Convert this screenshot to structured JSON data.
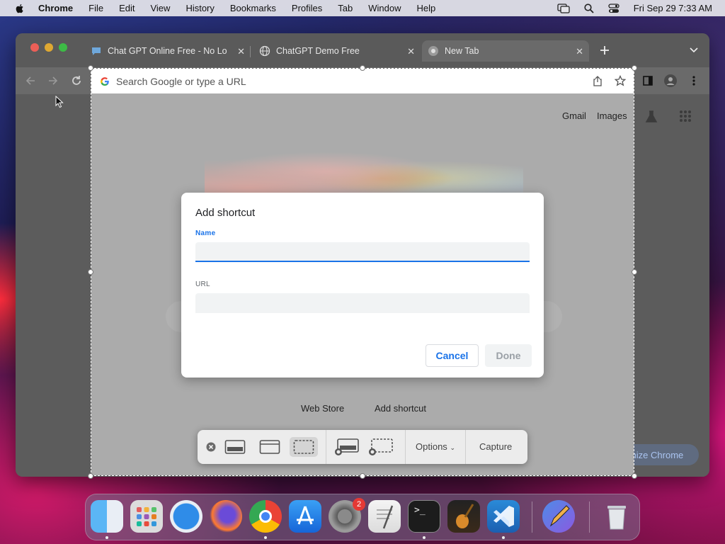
{
  "menubar": {
    "app_name": "Chrome",
    "items": [
      "File",
      "Edit",
      "View",
      "History",
      "Bookmarks",
      "Profiles",
      "Tab",
      "Window",
      "Help"
    ],
    "clock": "Fri Sep 29  7:33 AM"
  },
  "browser": {
    "tabs": [
      {
        "title": "Chat GPT Online Free - No Lo",
        "icon": "chat-bubble-icon"
      },
      {
        "title": "ChatGPT Demo Free",
        "icon": "globe-icon"
      },
      {
        "title": "New Tab",
        "icon": "chrome-icon"
      }
    ],
    "omnibox_placeholder": "Search Google or type a URL",
    "page_links": {
      "gmail": "Gmail",
      "images": "Images"
    },
    "shortcuts": {
      "web_store": "Web Store",
      "add_shortcut": "Add shortcut"
    },
    "customize_label": "Customize Chrome"
  },
  "dialog": {
    "title": "Add shortcut",
    "name_label": "Name",
    "name_value": "",
    "url_label": "URL",
    "url_value": "",
    "cancel_label": "Cancel",
    "done_label": "Done",
    "accent_color": "#1a73e8"
  },
  "screenshot_toolbar": {
    "options_label": "Options",
    "capture_label": "Capture",
    "selected_mode": "capture-selected-portion"
  },
  "dock": {
    "apps": [
      "Finder",
      "Launchpad",
      "Safari",
      "Firefox",
      "Chrome",
      "App Store",
      "System Settings",
      "TextEdit",
      "Terminal",
      "GarageBand",
      "Visual Studio Code",
      "Pencil",
      "Trash"
    ],
    "settings_badge": "2"
  }
}
